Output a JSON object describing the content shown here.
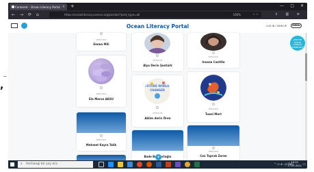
{
  "browser": {
    "tab_title": "Centered – Ocean Literacy Portal",
    "tab_close": "×",
    "new_tab": "+",
    "url": "https://oceanliteracy.unesco.org/portals/?post_type=all",
    "url_zoom": "100%",
    "nav_back": "←",
    "nav_forward": "→",
    "nav_reload": "⟳",
    "nav_home": "⌂",
    "win_min": "—",
    "win_max": "▢",
    "win_close": "✕",
    "toolbar_icons": "⇓ ▥ ≡",
    "url_icons": "☆ ☆"
  },
  "site": {
    "title": "Ocean Literacy Portal",
    "login_label": "LOG IN / SIGN UP",
    "menu_label": "MENU",
    "join_label": "JOIN THE OCEAN LITERACY COMMUNITY",
    "fab_label": "+"
  },
  "cards": {
    "col1": [
      {
        "type": "PERSON",
        "name": "Emma Mili"
      },
      {
        "type": "PERSON",
        "name": "Ela Merve AKSU"
      },
      {
        "type": "PERSON",
        "name": "Mehmet Kayra Telik"
      }
    ],
    "col2": [
      {
        "type": "PERSON",
        "name": "Alya Derin Şentürk"
      },
      {
        "type": "PERSON",
        "name": "Aklim derin Ören",
        "image_text": "FUTURE WORLD CHANGER"
      },
      {
        "type": "PERSON",
        "name": "Bade Bozkurtoğlu"
      }
    ],
    "col3": [
      {
        "type": "PERSON",
        "name": "Insana Castillo"
      },
      {
        "type": "PERSON",
        "name": "Tuani Mert"
      },
      {
        "type": "PERSON",
        "name": "Can Toprak Zeren"
      }
    ]
  },
  "taskbar": {
    "search_placeholder": "Herhangi bir şey ara",
    "search_icon": "⌕",
    "tray_text": "^ ⊡ ⊕ ◁) ENG",
    "time": "13:22",
    "date": "17.05.2021",
    "notif_icon": "▭"
  },
  "photo": {
    "comma": ",",
    "dash": "~"
  }
}
